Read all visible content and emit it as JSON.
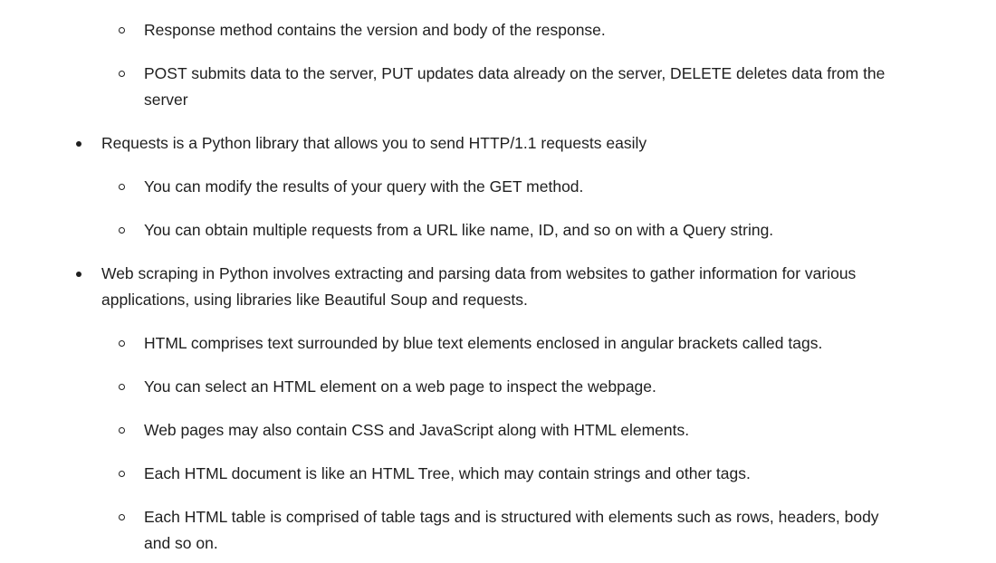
{
  "items": [
    {
      "level": 2,
      "text": "Response method contains the version and body of the response."
    },
    {
      "level": 2,
      "text": "POST submits data to the server, PUT updates data already on the server, DELETE deletes data from the server"
    },
    {
      "level": 1,
      "text": "Requests is a Python library that allows you to send HTTP/1.1 requests easily"
    },
    {
      "level": 2,
      "text": "You can modify the results of your query with the GET method."
    },
    {
      "level": 2,
      "text": "You can obtain multiple requests from a URL like name, ID, and so on with a Query string."
    },
    {
      "level": 1,
      "text": "Web scraping in Python involves extracting and parsing data from websites to gather information for various applications, using libraries like Beautiful Soup and requests."
    },
    {
      "level": 2,
      "text": "HTML comprises text surrounded by blue text elements enclosed in angular brackets called tags."
    },
    {
      "level": 2,
      "text": "You can select an HTML element on a web page to inspect the webpage."
    },
    {
      "level": 2,
      "text": "Web pages may also contain CSS and JavaScript along with HTML elements."
    },
    {
      "level": 2,
      "text": "Each HTML document is like an HTML Tree, which may contain strings and other tags."
    },
    {
      "level": 2,
      "text": "Each HTML table is comprised of table tags and is structured with elements such as rows, headers, body and so on."
    }
  ]
}
